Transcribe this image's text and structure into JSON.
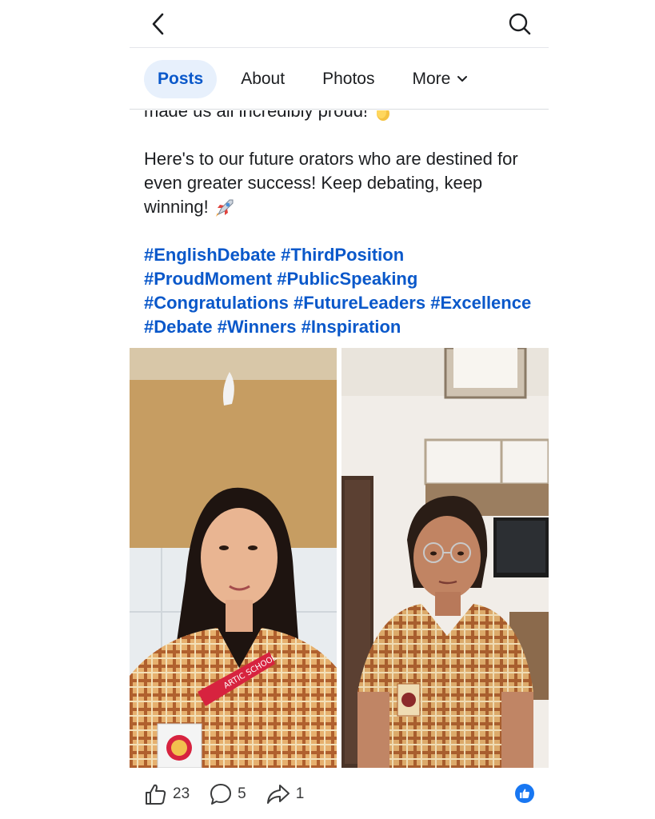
{
  "tabs": [
    {
      "label": "Posts",
      "active": true
    },
    {
      "label": "About"
    },
    {
      "label": "Photos"
    },
    {
      "label": "More"
    }
  ],
  "post": {
    "cut_line": "made us all incredibly proud!",
    "paragraph": "Here's to our future orators who are destined for even greater success! Keep debating, keep winning!",
    "hashtags": [
      [
        "#EnglishDebate",
        "#ThirdPosition"
      ],
      [
        "#ProudMoment",
        "#PublicSpeaking"
      ],
      [
        "#Congratulations",
        "#FutureLeaders",
        "#Excellence"
      ],
      [
        "#Debate",
        "#Winners",
        "#Inspiration"
      ]
    ],
    "emojis": {
      "clap": "clapping-hands-emoji",
      "rocket": "rocket-emoji"
    }
  },
  "photos": {
    "left_lanyard_text": "ARTIC SCHOOL",
    "count": 2
  },
  "actions": {
    "likes": "23",
    "comments": "5",
    "shares": "1"
  },
  "colors": {
    "accent": "#0a58ca",
    "tab_active_bg": "#e7f0fc",
    "like_blue": "#1877f2"
  },
  "icons": [
    "back-arrow-icon",
    "search-icon",
    "chevron-down-icon",
    "like-icon",
    "comment-icon",
    "share-icon",
    "like-reaction-icon"
  ]
}
